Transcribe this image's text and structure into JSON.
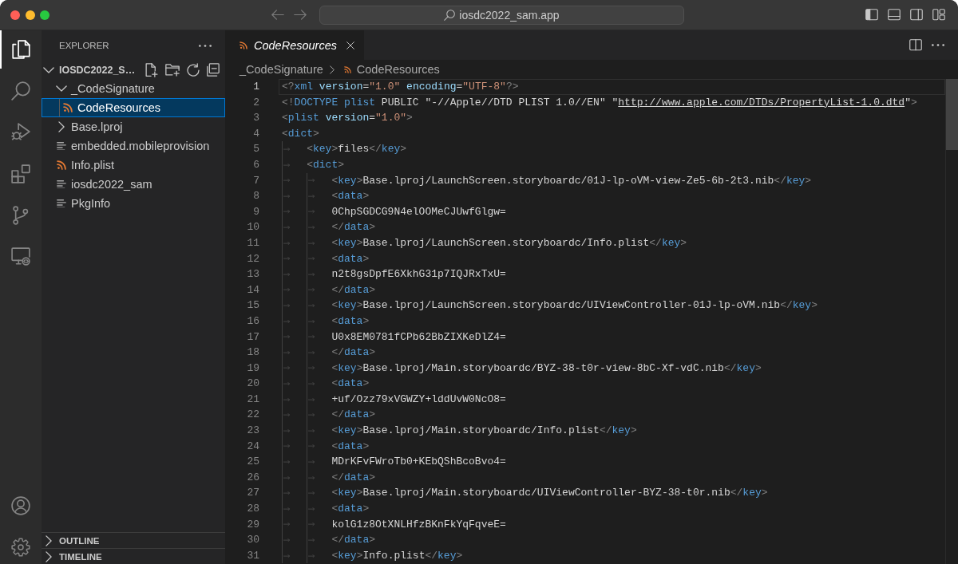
{
  "title_bar": {
    "command_center": "iosdc2022_sam.app",
    "layout_toggles": [
      {
        "kind": "primary_sidebar",
        "on": true
      },
      {
        "kind": "panel",
        "on": false
      },
      {
        "kind": "secondary_sidebar",
        "on": false
      }
    ]
  },
  "activity_bar": {
    "items": [
      {
        "kind": "explorer",
        "selected": true
      },
      {
        "kind": "search",
        "selected": false
      },
      {
        "kind": "run_debug",
        "selected": false
      },
      {
        "kind": "extensions",
        "selected": false
      },
      {
        "kind": "source_control",
        "selected": false
      },
      {
        "kind": "remote",
        "selected": false
      }
    ]
  },
  "sidebar": {
    "title": "EXPLORER",
    "root": {
      "label": "IOSDC2022_S…",
      "expanded": true
    },
    "tree": [
      {
        "label": "_CodeSignature",
        "kind": "folder",
        "expanded": true,
        "selected": false,
        "children": [
          {
            "label": "CodeResources",
            "kind": "xml",
            "selected": true
          }
        ]
      },
      {
        "label": "Base.lproj",
        "kind": "folder",
        "expanded": false,
        "selected": false
      },
      {
        "label": "embedded.mobileprovision",
        "kind": "text",
        "selected": false
      },
      {
        "label": "Info.plist",
        "kind": "xml",
        "selected": false
      },
      {
        "label": "iosdc2022_sam",
        "kind": "text",
        "selected": false
      },
      {
        "label": "PkgInfo",
        "kind": "text",
        "selected": false
      }
    ],
    "sections": [
      {
        "label": "OUTLINE",
        "expanded": false
      },
      {
        "label": "TIMELINE",
        "expanded": false
      }
    ]
  },
  "editor": {
    "tabs": [
      {
        "label": "CodeResources",
        "kind": "xml",
        "selected": true,
        "preview": true
      }
    ],
    "breadcrumbs": [
      {
        "label": "_CodeSignature",
        "kind": "folder"
      },
      {
        "label": "CodeResources",
        "kind": "xml"
      }
    ],
    "lines": [
      {
        "number": "1",
        "text": "<?xml version=\"1.0\" encoding=\"UTF-8\"?>",
        "current": true
      },
      {
        "number": "2",
        "text": "<!DOCTYPE plist PUBLIC \"-//Apple//DTD PLIST 1.0//EN\" \"http://www.apple.com/DTDs/PropertyList-1.0.dtd\">",
        "current": false
      },
      {
        "number": "3",
        "text": "<plist version=\"1.0\">",
        "current": false
      },
      {
        "number": "4",
        "text": "<dict>",
        "current": false
      },
      {
        "number": "5",
        "text": "\t<key>files</key>",
        "current": false
      },
      {
        "number": "6",
        "text": "\t<dict>",
        "current": false
      },
      {
        "number": "7",
        "text": "\t\t<key>Base.lproj/LaunchScreen.storyboardc/01J-lp-oVM-view-Ze5-6b-2t3.nib</key>",
        "current": false
      },
      {
        "number": "8",
        "text": "\t\t<data>",
        "current": false
      },
      {
        "number": "9",
        "text": "\t\t0ChpSGDCG9N4elOOMeCJUwfGlgw=",
        "current": false
      },
      {
        "number": "10",
        "text": "\t\t</data>",
        "current": false
      },
      {
        "number": "11",
        "text": "\t\t<key>Base.lproj/LaunchScreen.storyboardc/Info.plist</key>",
        "current": false
      },
      {
        "number": "12",
        "text": "\t\t<data>",
        "current": false
      },
      {
        "number": "13",
        "text": "\t\tn2t8gsDpfE6XkhG31p7IQJRxTxU=",
        "current": false
      },
      {
        "number": "14",
        "text": "\t\t</data>",
        "current": false
      },
      {
        "number": "15",
        "text": "\t\t<key>Base.lproj/LaunchScreen.storyboardc/UIViewController-01J-lp-oVM.nib</key>",
        "current": false
      },
      {
        "number": "16",
        "text": "\t\t<data>",
        "current": false
      },
      {
        "number": "17",
        "text": "\t\tU0x8EM0781fCPb62BbZIXKeDlZ4=",
        "current": false
      },
      {
        "number": "18",
        "text": "\t\t</data>",
        "current": false
      },
      {
        "number": "19",
        "text": "\t\t<key>Base.lproj/Main.storyboardc/BYZ-38-t0r-view-8bC-Xf-vdC.nib</key>",
        "current": false
      },
      {
        "number": "20",
        "text": "\t\t<data>",
        "current": false
      },
      {
        "number": "21",
        "text": "\t\t+uf/Ozz79xVGWZY+lddUvW0NcO8=",
        "current": false
      },
      {
        "number": "22",
        "text": "\t\t</data>",
        "current": false
      },
      {
        "number": "23",
        "text": "\t\t<key>Base.lproj/Main.storyboardc/Info.plist</key>",
        "current": false
      },
      {
        "number": "24",
        "text": "\t\t<data>",
        "current": false
      },
      {
        "number": "25",
        "text": "\t\tMDrKFvFWroTb0+KEbQShBcoBvo4=",
        "current": false
      },
      {
        "number": "26",
        "text": "\t\t</data>",
        "current": false
      },
      {
        "number": "27",
        "text": "\t\t<key>Base.lproj/Main.storyboardc/UIViewController-BYZ-38-t0r.nib</key>",
        "current": false
      },
      {
        "number": "28",
        "text": "\t\t<data>",
        "current": false
      },
      {
        "number": "29",
        "text": "\t\tkolG1z8OtXNLHfzBKnFkYqFqveE=",
        "current": false
      },
      {
        "number": "30",
        "text": "\t\t</data>",
        "current": false
      },
      {
        "number": "31",
        "text": "\t\t<key>Info.plist</key>",
        "current": false
      }
    ]
  }
}
